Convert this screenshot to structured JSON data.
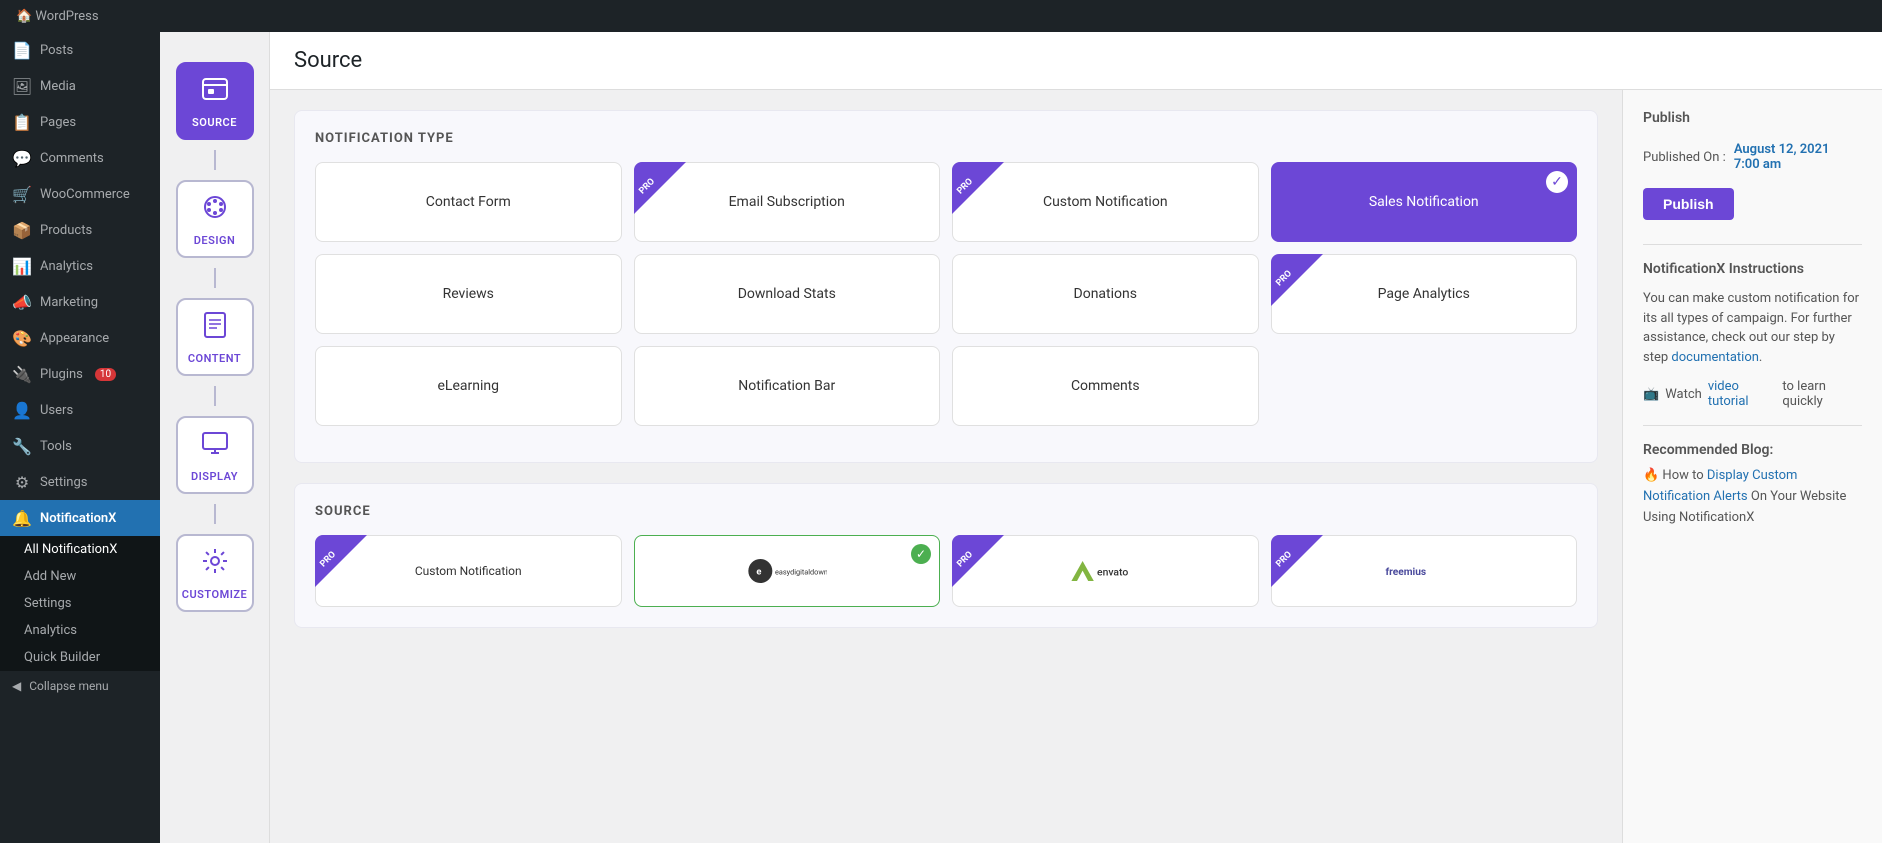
{
  "page": {
    "title": "Source"
  },
  "adminBar": {
    "title": "WordPress"
  },
  "sidebar": {
    "items": [
      {
        "id": "posts",
        "label": "Posts",
        "icon": "📄"
      },
      {
        "id": "media",
        "label": "Media",
        "icon": "🖼"
      },
      {
        "id": "pages",
        "label": "Pages",
        "icon": "📋"
      },
      {
        "id": "comments",
        "label": "Comments",
        "icon": "💬"
      },
      {
        "id": "woocommerce",
        "label": "WooCommerce",
        "icon": "🛒"
      },
      {
        "id": "products",
        "label": "Products",
        "icon": "📦"
      },
      {
        "id": "analytics",
        "label": "Analytics",
        "icon": "📊"
      },
      {
        "id": "marketing",
        "label": "Marketing",
        "icon": "📣"
      },
      {
        "id": "appearance",
        "label": "Appearance",
        "icon": "🎨"
      },
      {
        "id": "plugins",
        "label": "Plugins",
        "icon": "🔌",
        "badge": "10"
      },
      {
        "id": "users",
        "label": "Users",
        "icon": "👤"
      },
      {
        "id": "tools",
        "label": "Tools",
        "icon": "🔧"
      },
      {
        "id": "settings",
        "label": "Settings",
        "icon": "⚙"
      },
      {
        "id": "notificationx",
        "label": "NotificationX",
        "icon": "🔔",
        "active": true
      }
    ],
    "subItems": [
      {
        "id": "all-notificationx",
        "label": "All NotificationX",
        "active": true
      },
      {
        "id": "add-new",
        "label": "Add New"
      },
      {
        "id": "settings",
        "label": "Settings"
      },
      {
        "id": "analytics-sub",
        "label": "Analytics"
      },
      {
        "id": "quick-builder",
        "label": "Quick Builder"
      }
    ],
    "collapseLabel": "Collapse menu"
  },
  "steps": [
    {
      "id": "source",
      "label": "SOURCE",
      "icon": "⬡",
      "active": true
    },
    {
      "id": "design",
      "label": "DESIGN",
      "icon": "🎨"
    },
    {
      "id": "content",
      "label": "CONTENT",
      "icon": "📄"
    },
    {
      "id": "display",
      "label": "DISPLAY",
      "icon": "🖥"
    },
    {
      "id": "customize",
      "label": "CUSTOMIZE",
      "icon": "⚙"
    }
  ],
  "notificationTypes": {
    "sectionTitle": "NOTIFICATION TYPE",
    "cards": [
      {
        "id": "contact-form",
        "label": "Contact Form",
        "pro": false,
        "selected": false
      },
      {
        "id": "email-subscription",
        "label": "Email Subscription",
        "pro": true,
        "selected": false
      },
      {
        "id": "custom-notification",
        "label": "Custom Notification",
        "pro": true,
        "selected": false
      },
      {
        "id": "sales-notification",
        "label": "Sales Notification",
        "pro": false,
        "selected": true
      },
      {
        "id": "reviews",
        "label": "Reviews",
        "pro": false,
        "selected": false
      },
      {
        "id": "download-stats",
        "label": "Download Stats",
        "pro": false,
        "selected": false
      },
      {
        "id": "donations",
        "label": "Donations",
        "pro": false,
        "selected": false
      },
      {
        "id": "page-analytics",
        "label": "Page Analytics",
        "pro": true,
        "selected": false
      },
      {
        "id": "elearning",
        "label": "eLearning",
        "pro": false,
        "selected": false
      },
      {
        "id": "notification-bar",
        "label": "Notification Bar",
        "pro": false,
        "selected": false
      },
      {
        "id": "comments",
        "label": "Comments",
        "pro": false,
        "selected": false
      }
    ]
  },
  "sourceSection": {
    "sectionTitle": "SOURCE",
    "cards": [
      {
        "id": "custom-notification-src",
        "label": "Custom Notification",
        "pro": true,
        "checked": false
      },
      {
        "id": "edd",
        "label": "easydigi taldownloads",
        "pro": false,
        "checked": true
      },
      {
        "id": "envato",
        "label": "envato",
        "pro": true,
        "checked": false
      },
      {
        "id": "freemius",
        "label": "freemius",
        "pro": true,
        "checked": false
      }
    ]
  },
  "rightSidebar": {
    "publishTitle": "Publish",
    "publishedOnLabel": "Published On :",
    "publishedDate": "August 12, 2021",
    "publishedTime": "7:00 am",
    "publishButton": "Publish",
    "instructionsTitle": "NotificationX Instructions",
    "instructionsText": "You can make custom notification for its all types of campaign. For further assistance, check out our step by step",
    "documentationLink": "documentation",
    "watchText": "Watch",
    "videoLink": "video tutorial",
    "watchSuffix": "to learn quickly",
    "recommendedTitle": "Recommended Blog:",
    "blogText": "How to",
    "blogLink": "Display Custom Notification Alerts",
    "blogSuffix": "On Your Website Using NotificationX"
  }
}
